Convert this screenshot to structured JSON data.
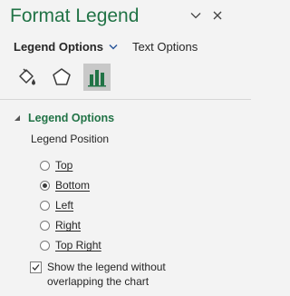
{
  "pane": {
    "title": "Format Legend",
    "pin_icon": "chevron-down-icon",
    "close_icon": "close-icon"
  },
  "tabs": {
    "active_label": "Legend Options",
    "other_label": "Text Options"
  },
  "icon_tabs": [
    {
      "name": "fill-line",
      "icon": "paint-bucket-icon"
    },
    {
      "name": "effects",
      "icon": "pentagon-icon"
    },
    {
      "name": "legend-options",
      "icon": "bar-chart-icon",
      "selected": true
    }
  ],
  "section": {
    "title": "Legend Options",
    "expanded": true
  },
  "legend_position": {
    "label": "Legend Position",
    "options": [
      {
        "label": "Top",
        "checked": false
      },
      {
        "label": "Bottom",
        "checked": true
      },
      {
        "label": "Left",
        "checked": false
      },
      {
        "label": "Right",
        "checked": false
      },
      {
        "label": "Top Right",
        "checked": false
      }
    ]
  },
  "overlap_checkbox": {
    "label": "Show the legend without overlapping the chart",
    "checked": true
  },
  "colors": {
    "accent": "#217346",
    "background": "#f3f3f3",
    "selected_tab": "#c8c8c8"
  }
}
